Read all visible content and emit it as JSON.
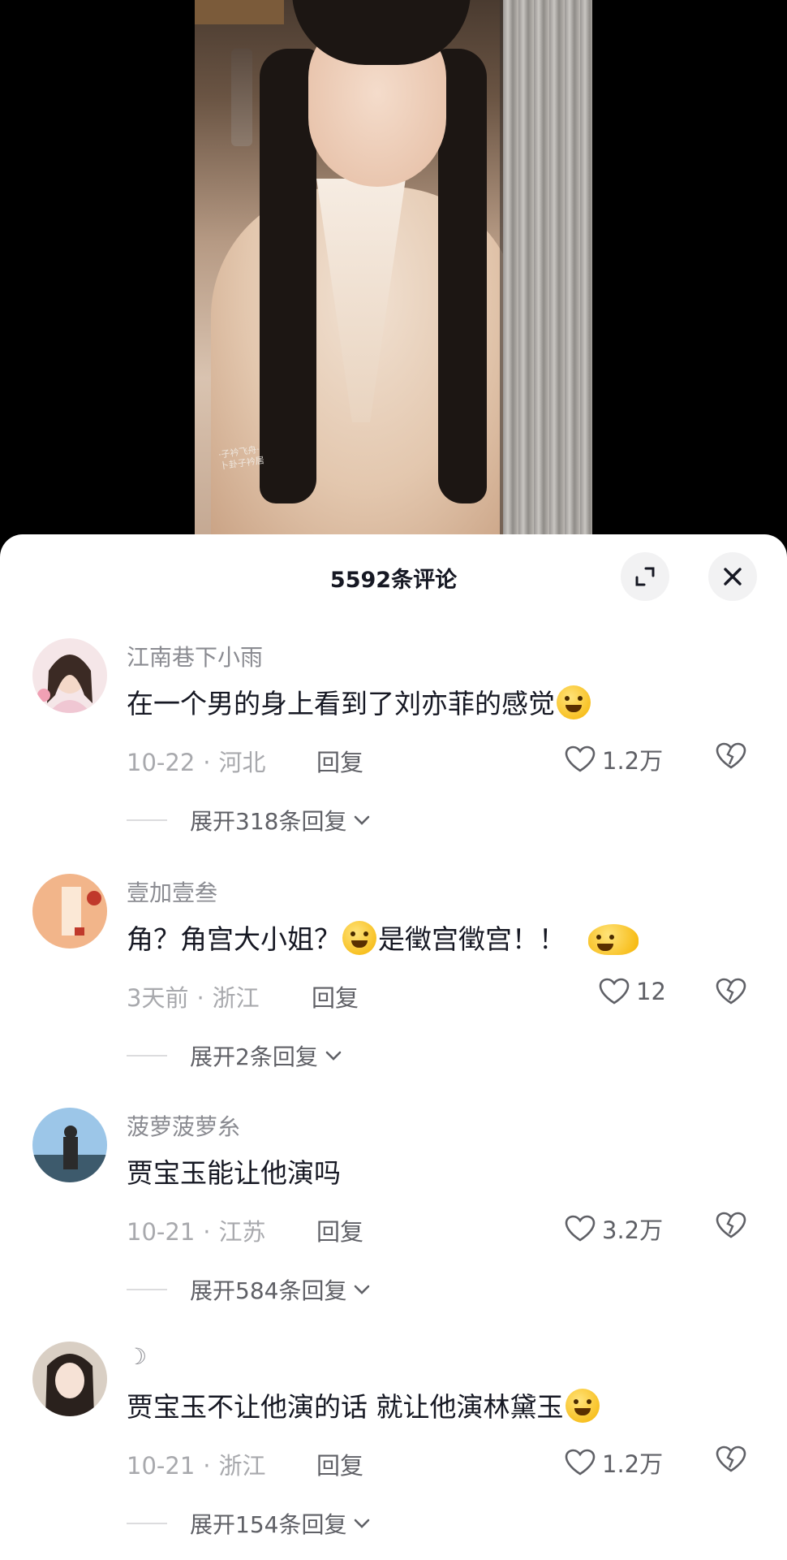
{
  "panel": {
    "title": "5592条评论"
  },
  "video": {
    "watermark_line1": "·子衿飞舟·",
    "watermark_line2": "卜卦子衿居"
  },
  "comments": [
    {
      "username": "江南巷下小雨",
      "text": "在一个男的身上看到了刘亦菲的感觉",
      "emoji_after": "laughing-tears-emoji",
      "date": "10-22",
      "location": "河北",
      "reply_label": "回复",
      "likes": "1.2万",
      "expand_label": "展开318条回复"
    },
    {
      "username": "壹加壹叁",
      "text_before": "角？角宫大小姐？",
      "text_after": "是徵宫徵宫！！",
      "date": "3天前",
      "location": "浙江",
      "reply_label": "回复",
      "likes": "12",
      "expand_label": "展开2条回复"
    },
    {
      "username": "菠萝菠萝糸",
      "text": "贾宝玉能让他演吗",
      "date": "10-21",
      "location": "江苏",
      "reply_label": "回复",
      "likes": "3.2万",
      "expand_label": "展开584条回复"
    },
    {
      "username": "☽",
      "text": "贾宝玉不让他演的话 就让他演林黛玉",
      "date": "10-21",
      "location": "浙江",
      "reply_label": "回复",
      "likes": "1.2万",
      "expand_label": "展开154条回复"
    }
  ],
  "colors": {
    "panel_bg": "#ffffff",
    "primary_text": "#161823",
    "secondary_text": "#8a8b91",
    "meta_text": "#a8a9ad"
  }
}
